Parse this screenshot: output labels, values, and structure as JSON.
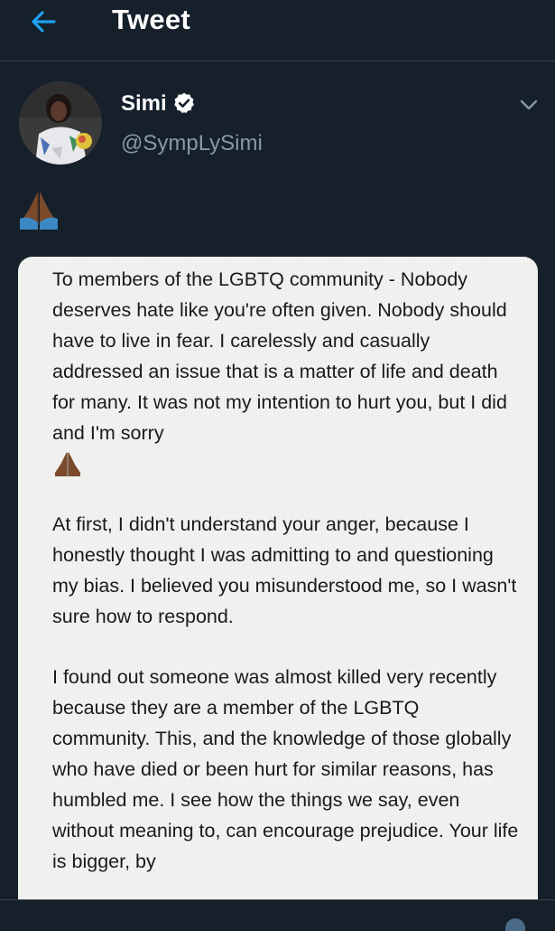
{
  "header": {
    "title": "Tweet"
  },
  "author": {
    "name": "Simi",
    "handle": "@SympLySimi",
    "verified": true
  },
  "tweet": {
    "emoji": "🙏🏾"
  },
  "note": {
    "paragraph1_text": "To members of the LGBTQ community - Nobody deserves hate like you're often given. Nobody should have to live in fear. I carelessly and casually addressed an issue that is a matter of life and death for many. It was not my intention to hurt you, but I did and I'm sorry",
    "paragraph1_emoji": "🙏🏾",
    "paragraph2": "At first, I didn't understand your anger, because I honestly thought I was admitting to and questioning my bias. I believed you misunderstood me, so I wasn't sure how to respond.",
    "paragraph3": "I found out someone was almost killed very recently because they are a member of the LGBTQ community. This, and the knowledge of those globally who have died or been hurt for similar reasons, has humbled me. I see how the things we say, even without meaning to, can encourage prejudice. Your life is bigger, by"
  },
  "colors": {
    "background": "#15202b",
    "accent": "#1da1f2",
    "secondary_text": "#8899a6",
    "divider": "#38444d",
    "card_background": "#f2f2f0"
  },
  "icons": {
    "back": "back-arrow-icon",
    "verified": "verified-badge-icon",
    "menu": "chevron-down-icon",
    "emoji": "folded-hands-icon"
  }
}
